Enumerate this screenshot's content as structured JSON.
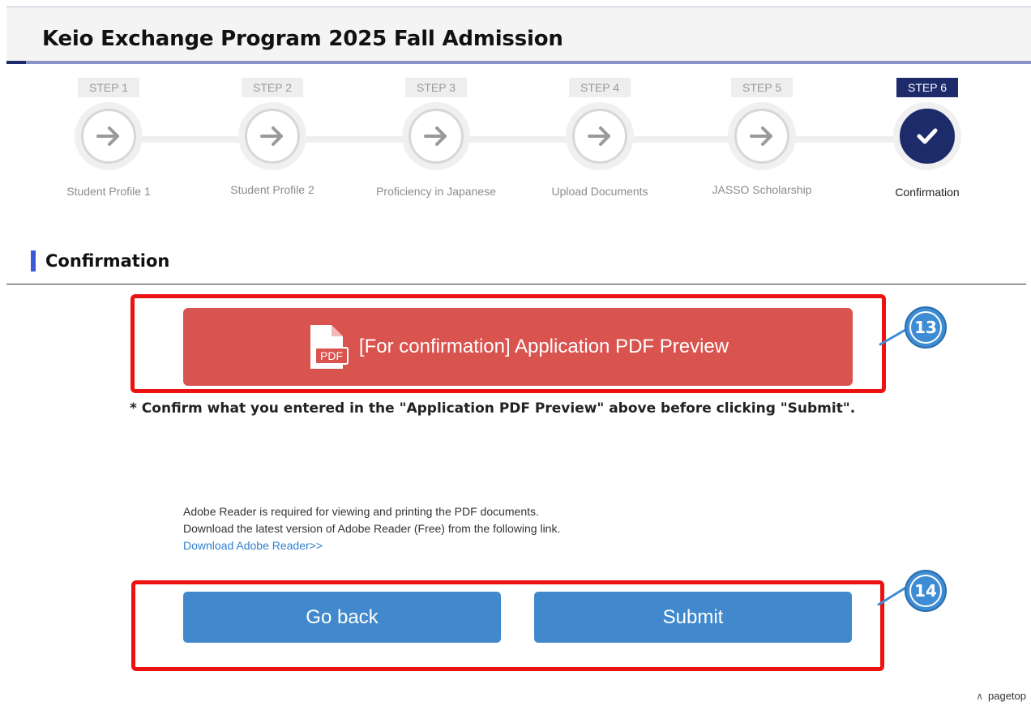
{
  "header": {
    "title": "Keio Exchange Program 2025 Fall Admission"
  },
  "steps": [
    {
      "badge": "STEP 1",
      "label": "Student Profile 1",
      "icon": "arrow-right-icon",
      "active": false
    },
    {
      "badge": "STEP 2",
      "label": "Student Profile 2",
      "icon": "arrow-right-icon",
      "active": false
    },
    {
      "badge": "STEP 3",
      "label": "Proficiency in Japanese",
      "icon": "arrow-right-icon",
      "active": false
    },
    {
      "badge": "STEP 4",
      "label": "Upload Documents",
      "icon": "arrow-right-icon",
      "active": false
    },
    {
      "badge": "STEP 5",
      "label": "JASSO Scholarship",
      "icon": "arrow-right-icon",
      "active": false
    },
    {
      "badge": "STEP 6",
      "label": "Confirmation",
      "icon": "checkmark-icon",
      "active": true
    }
  ],
  "section": {
    "title": "Confirmation"
  },
  "pdf_preview": {
    "label": "[For confirmation] Application PDF Preview",
    "icon": "pdf-file-icon",
    "note": "* Confirm what you entered in the \"Application PDF Preview\" above before clicking \"Submit\"."
  },
  "adobe": {
    "line1": "Adobe Reader is required for viewing and printing the PDF documents.",
    "line2": "Download the latest version of Adobe Reader (Free) from the following link.",
    "link": "Download Adobe Reader>>"
  },
  "actions": {
    "back_label": "Go back",
    "submit_label": "Submit"
  },
  "markers": {
    "first": "13",
    "second": "14"
  },
  "pagetop": {
    "label": "pagetop",
    "icon": "caret-up-icon"
  },
  "colors": {
    "active_step": "#1d2b6b",
    "pdf_button": "#d9534f",
    "action_button": "#4189cc",
    "annotation_box": "#ee1111",
    "marker": "#3e8cd4",
    "link": "#2f7fd0"
  }
}
